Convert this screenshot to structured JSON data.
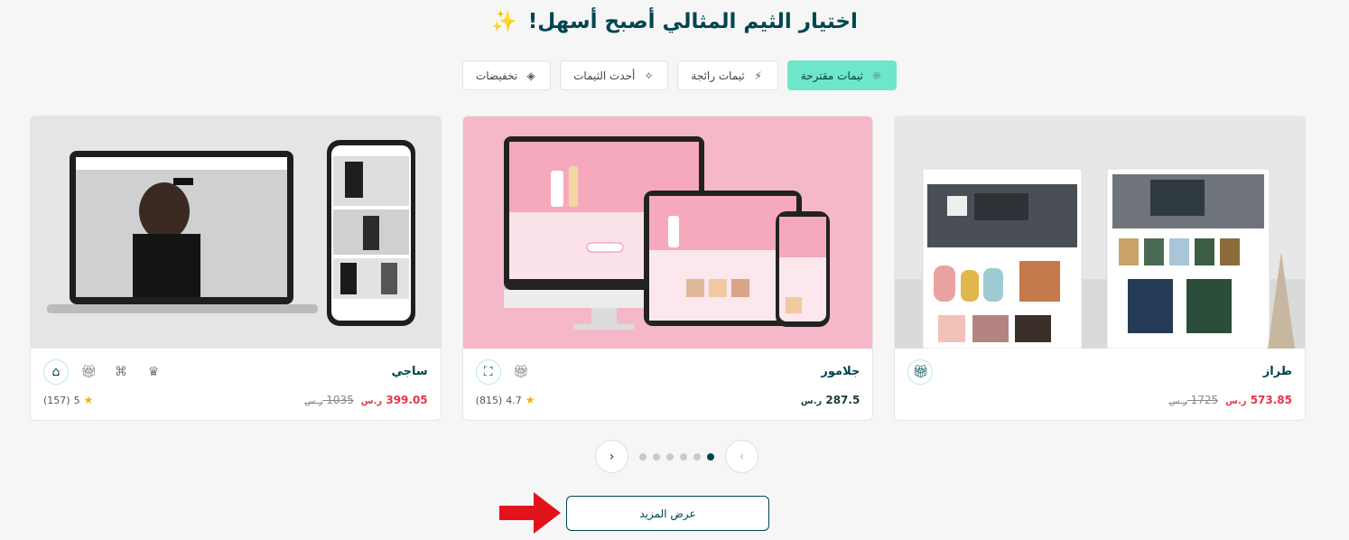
{
  "heading": "اختيار الثيم المثالي أصبح أسهل!",
  "tabs": [
    {
      "label": "ثيمات مقترحة",
      "icon": "lightbulb-icon",
      "active": true
    },
    {
      "label": "ثيمات رائجة",
      "icon": "trending-icon",
      "active": false
    },
    {
      "label": "أحدث الثيمات",
      "icon": "magic-wand-icon",
      "active": false
    },
    {
      "label": "تخفيضات",
      "icon": "tag-icon",
      "active": false
    }
  ],
  "cards": [
    {
      "title": "طراز",
      "price": "573.85",
      "old_price": "1725",
      "currency": "ر.س"
    },
    {
      "title": "جلامور",
      "price": "287.5",
      "currency": "ر.س",
      "rating": "4.7",
      "reviews": "(815)"
    },
    {
      "title": "ساجي",
      "price": "399.05",
      "old_price": "1035",
      "currency": "ر.س",
      "rating": "5",
      "reviews": "(157)"
    }
  ],
  "pagination": {
    "active_page": 1,
    "total_pages": 6
  },
  "more_button": "عرض المزيد",
  "colors": {
    "accent": "#6ee6c9",
    "brand": "#00454f",
    "sale": "#e2364a",
    "arrow": "#e3131b"
  }
}
